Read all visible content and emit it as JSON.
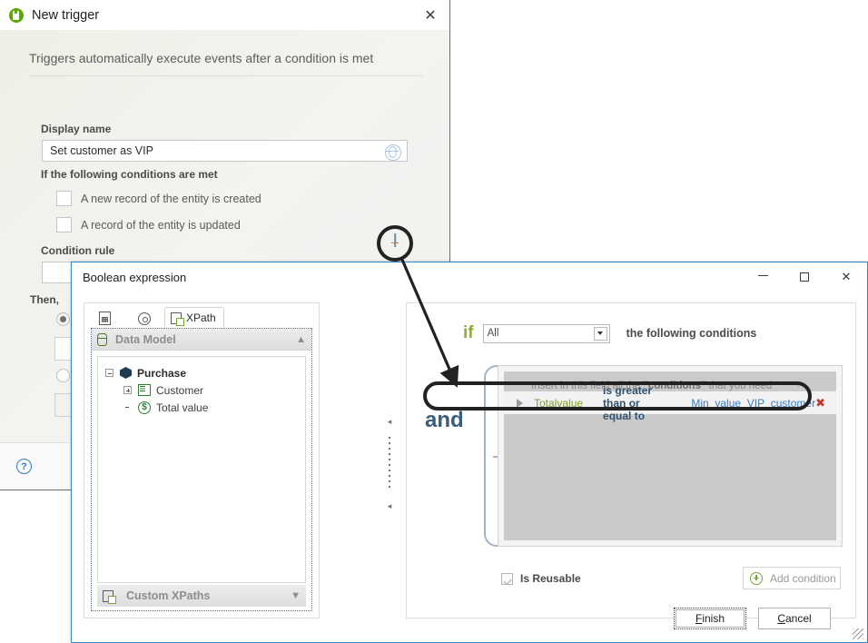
{
  "trigger_window": {
    "title": "New trigger",
    "logo_icon": "mendix-logo-icon",
    "close_icon": "✕",
    "subtitle": "Triggers automatically execute events after a condition is met",
    "display_name_label": "Display name",
    "display_name_value": "Set customer as VIP",
    "display_name_icon": "globe-target-icon",
    "conditions_met_label": "If the following conditions are met",
    "checkboxes": [
      {
        "label": "A new record of the entity is created",
        "checked": false
      },
      {
        "label": "A record of the entity is updated",
        "checked": false
      }
    ],
    "condition_rule_label": "Condition rule",
    "condition_rule_value": "",
    "then_label": "Then,",
    "help_icon": "?"
  },
  "boolean_window": {
    "title": "Boolean expression",
    "minimize_icon": "minimize-icon",
    "maximize_icon": "maximize-icon",
    "close_icon": "✕",
    "left_panel": {
      "tabs": [
        {
          "name": "document-tab",
          "label": "",
          "icon": "document-grid-icon",
          "active": false
        },
        {
          "name": "settings-tab",
          "label": "",
          "icon": "gear-icon",
          "active": false
        },
        {
          "name": "xpath-tab",
          "label": "XPath",
          "icon": "xpath-icon",
          "active": true
        }
      ],
      "data_model": {
        "header": "Data Model",
        "header_icon": "database-icon",
        "collapse_icon": "chevron-up-icon",
        "tree": [
          {
            "label": "Purchase",
            "icon": "entity-icon",
            "expander": "minus",
            "level": 1,
            "bold": true
          },
          {
            "label": "Customer",
            "icon": "association-icon",
            "expander": "plus",
            "level": 2,
            "bold": false
          },
          {
            "label": "Total value",
            "icon": "currency-icon",
            "expander": "none",
            "level": 2,
            "bold": false
          }
        ]
      },
      "custom_xpaths": {
        "header": "Custom XPaths",
        "header_icon": "xpath-icon",
        "expand_icon": "chevron-down-icon"
      }
    },
    "right_panel": {
      "if_word": "if",
      "if_select_value": "All",
      "if_select_caret": "chevron-down-icon",
      "if_tail_text": "the following conditions",
      "and_word": "and",
      "conditions_hint_prefix": "Insert in this field all the",
      "conditions_hint_quoted": "\"conditions\"",
      "conditions_hint_suffix": "that you need",
      "condition_rows": [
        {
          "expander_icon": "triangle-right-icon",
          "field": "Totalvalue",
          "operator": "is greater than or equal to",
          "value": "Min_value_VIP_customer",
          "delete_icon": "✖"
        }
      ],
      "is_reusable_label": "Is Reusable",
      "is_reusable_checked": true,
      "add_condition_label": "Add condition",
      "add_condition_icon": "plus-circle-icon"
    },
    "footer": {
      "finish_label": "Finish",
      "finish_accel": "F",
      "cancel_label": "Cancel",
      "cancel_accel": "C",
      "resize_grip_icon": "resize-grip-icon"
    }
  },
  "annotations": {
    "magnifier_plus_sign": "+",
    "highlight_circle_name": "add-condition-rule-highlight",
    "highlight_pill_name": "condition-row-highlight",
    "arrow_name": "pointer-arrow"
  },
  "colors": {
    "accent_blue": "#2b88d8",
    "brand_green": "#5aa700",
    "if_green": "#8fae2f",
    "and_blue": "#3b5d7d",
    "field_token": "#7ea32b",
    "value_token": "#3f7bbf",
    "delete_red": "#c0392b"
  }
}
